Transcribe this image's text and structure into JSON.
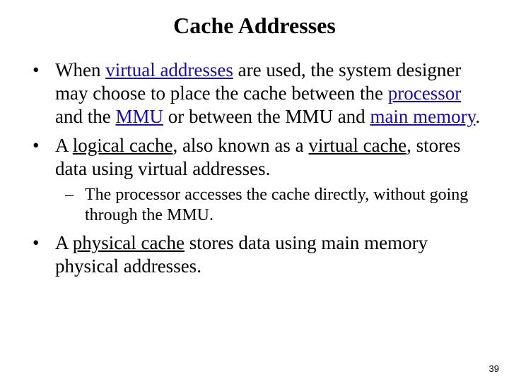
{
  "title": "Cache Addresses",
  "b1": {
    "t1": "When ",
    "link1": "virtual addresses",
    "t2": " are used, the system designer may choose to place the cache between the ",
    "link2": "processor",
    "t3": " and the ",
    "link3": "MMU",
    "t4": " or between the MMU and ",
    "link4": "main memory",
    "t5": "."
  },
  "b2": {
    "t1": "A ",
    "u1": "logical cache",
    "t2": ", also known as a ",
    "u2": "virtual cache",
    "t3": ", stores data using virtual addresses."
  },
  "b2sub": "The processor accesses the cache directly, without going through the MMU.",
  "b3": {
    "t1": "A ",
    "u1": "physical cache",
    "t2": " stores data using main memory physical addresses."
  },
  "pagenum": "39"
}
